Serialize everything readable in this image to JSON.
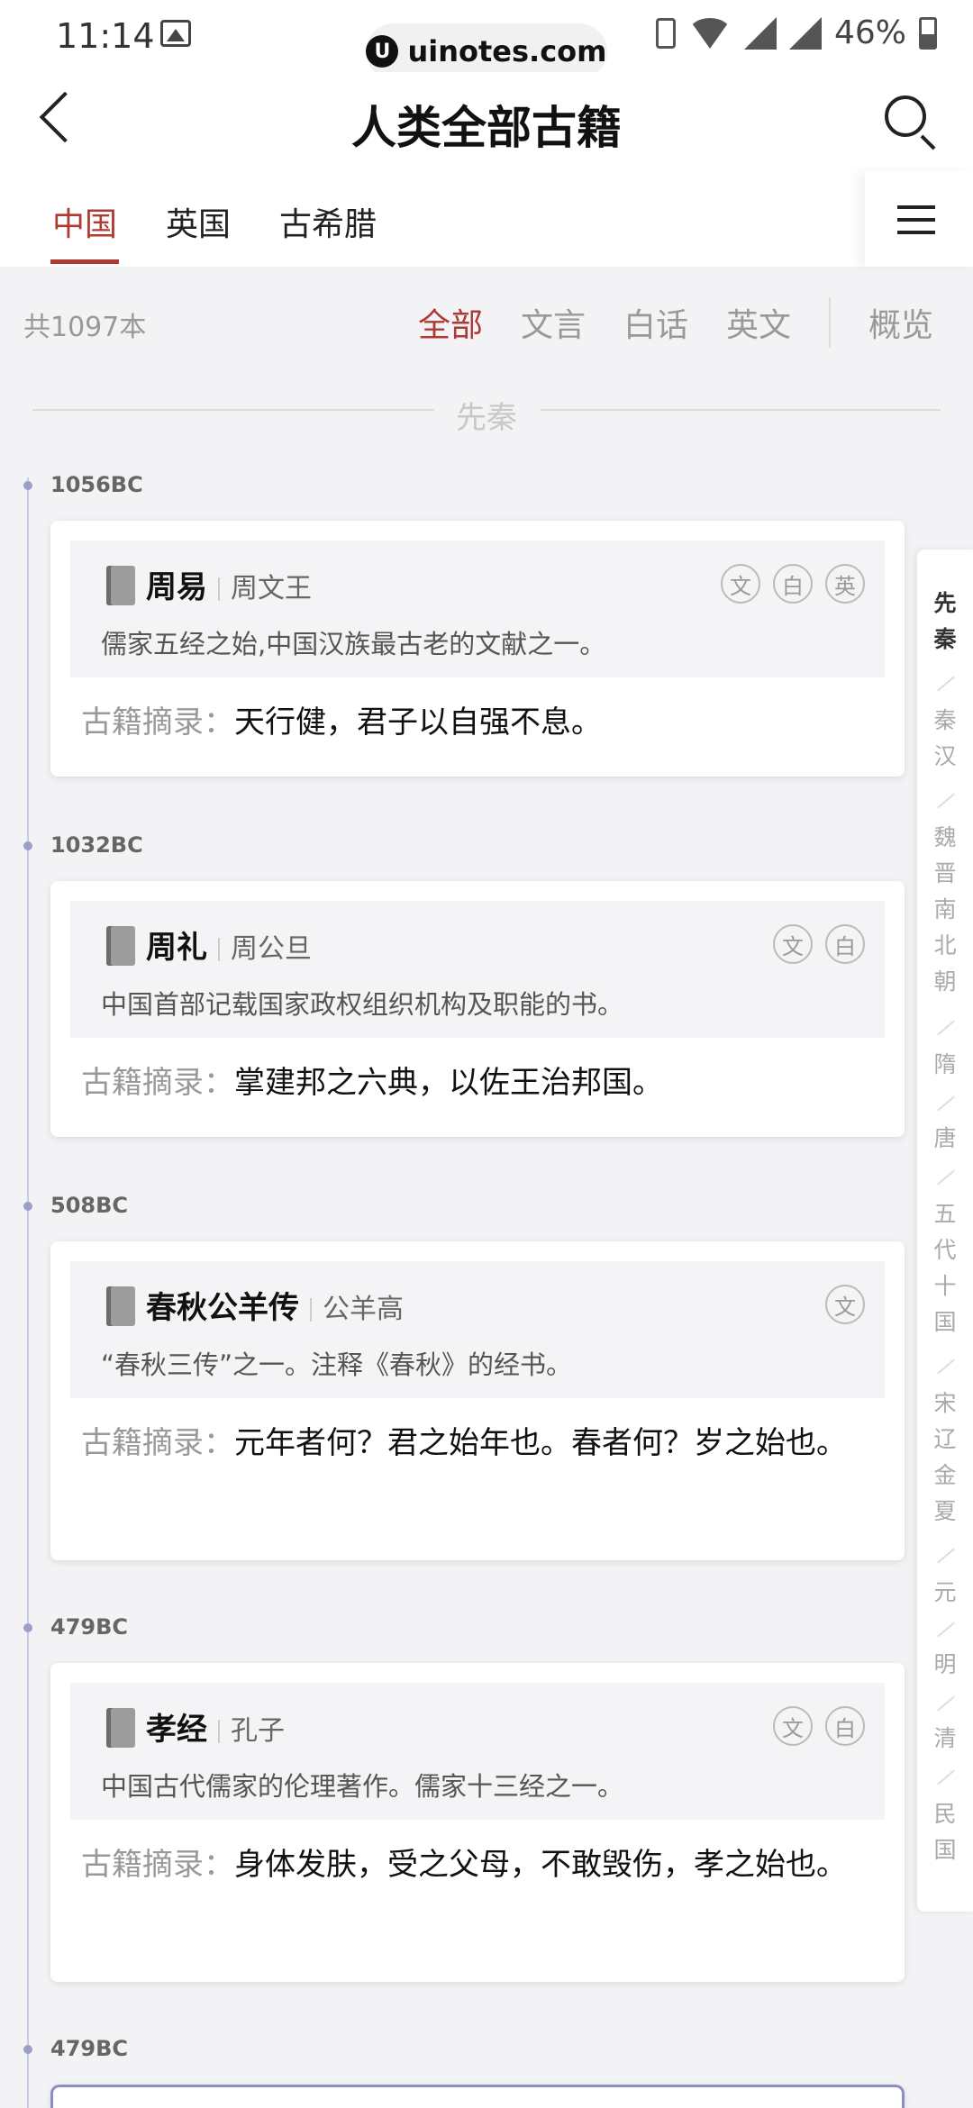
{
  "status": {
    "time": "11:14",
    "url": "uinotes.com",
    "battery": "46%"
  },
  "header": {
    "title": "人类全部古籍"
  },
  "tabs": [
    {
      "label": "中国",
      "active": true
    },
    {
      "label": "英国",
      "active": false
    },
    {
      "label": "古希腊",
      "active": false
    }
  ],
  "filter": {
    "count": "共1097本",
    "options": [
      "全部",
      "文言",
      "白话",
      "英文"
    ],
    "overview": "概览"
  },
  "era_header": "先秦",
  "excerpt_label": "古籍摘录：",
  "books": [
    {
      "year": "1056BC",
      "title": "周易",
      "author": "周文王",
      "badges": [
        "文",
        "白",
        "英"
      ],
      "desc": "儒家五经之始,中国汉族最古老的文献之一。",
      "excerpt": "天行健，君子以自强不息。"
    },
    {
      "year": "1032BC",
      "title": "周礼",
      "author": "周公旦",
      "badges": [
        "文",
        "白"
      ],
      "desc": "中国首部记载国家政权组织机构及职能的书。",
      "excerpt": "掌建邦之六典，以佐王治邦国。"
    },
    {
      "year": "508BC",
      "title": "春秋公羊传",
      "author": "公羊高",
      "badges": [
        "文"
      ],
      "desc": "“春秋三传”之一。注释《春秋》的经书。",
      "excerpt": "元年者何？君之始年也。春者何？岁之始也。"
    },
    {
      "year": "479BC",
      "title": "孝经",
      "author": "孔子",
      "badges": [
        "文",
        "白"
      ],
      "desc": "中国古代儒家的伦理著作。儒家十三经之一。",
      "excerpt": "身体发肤，受之父母，不敢毁伤，孝之始也。"
    },
    {
      "year": "479BC"
    }
  ],
  "era_index": [
    "先秦",
    "秦汉",
    "魏晋南北朝",
    "隋",
    "唐",
    "五代十国",
    "宋辽金夏",
    "元",
    "明",
    "清",
    "民国"
  ]
}
